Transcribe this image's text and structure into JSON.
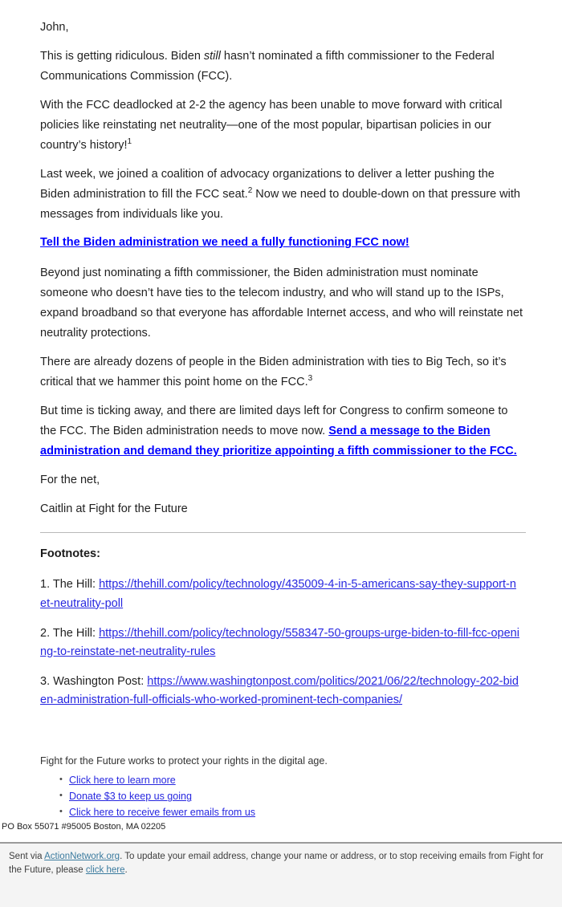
{
  "email": {
    "greeting": "John,",
    "paragraphs": [
      {
        "id": "p-ridiculous",
        "prefix": "This is getting ridiculous. Biden ",
        "italic": "still",
        "suffix": " hasn’t nominated a fifth commissioner to the Federal Communications Commission (FCC)."
      },
      {
        "id": "p-deadlock",
        "prefix": "With the FCC deadlocked at 2-2 the agency has been unable to move forward with critical policies like reinstating net neutrality—one of the most popular, bipartisan policies in our country’s history!",
        "superscript": "1",
        "suffix": ""
      },
      {
        "id": "p-coalition",
        "prefix": "Last week, we joined a coalition of advocacy organizations to deliver a letter pushing the Biden administration to fill the FCC seat.",
        "superscript": "2",
        "suffix": " Now we need to double-down on that pressure with messages from individuals like you."
      }
    ],
    "cta_primary": "Tell the Biden administration we need a fully functioning FCC now!",
    "paragraph_beyond": "Beyond just nominating a fifth commissioner, the Biden administration must nominate someone who doesn’t have ties to the telecom industry, and who will stand up to the ISPs, expand broadband so that everyone has affordable Internet access, and who will reinstate net neutrality protections.",
    "paragraph_bigtech": {
      "prefix": "There are already dozens of people in the Biden administration with ties to Big Tech, so it’s critical that we hammer this point home on the FCC.",
      "superscript": "3",
      "suffix": ""
    },
    "paragraph_ticking": {
      "prefix": "But time is ticking away, and there are limited days left for Congress to confirm someone to the FCC. The Biden administration needs to move now. ",
      "link": "Send a message to the Biden administration and demand they prioritize appointing a fifth commissioner to the FCC."
    },
    "signoff_line1": "For the net,",
    "signoff_line2": "Caitlin at Fight for the Future"
  },
  "footnotes": {
    "title": "Footnotes:",
    "items": [
      {
        "label": "1. The Hill: ",
        "url": "https://thehill.com/policy/technology/435009-4-in-5-americans-say-they-support-net-neutrality-poll"
      },
      {
        "label": "2. The Hill: ",
        "url": "https://thehill.com/policy/technology/558347-50-groups-urge-biden-to-fill-fcc-opening-to-reinstate-net-neutrality-rules"
      },
      {
        "label": "3. Washington Post: ",
        "url": "https://www.washingtonpost.com/politics/2021/06/22/technology-202-biden-administration-full-officials-who-worked-prominent-tech-companies/"
      }
    ]
  },
  "org_footer": {
    "tagline": "Fight for the Future works to protect your rights in the digital age.",
    "links": [
      "Click here to learn more",
      "Donate $3 to keep us going",
      "Click here to receive fewer emails from us"
    ]
  },
  "postal_address": "PO Box 55071 #95005 Boston, MA 02205",
  "action_bar": {
    "sent_via_prefix": "Sent via ",
    "provider_link": "ActionNetwork.org",
    "middle_text": ". To update your email address, change your name or address, or to stop receiving emails from Fight for the Future, please ",
    "click_here_link": "click here",
    "period": "."
  },
  "colors": {
    "cta_link": "#0000ff",
    "reference_link": "#2727e0",
    "footer_link": "#3a7a9e",
    "body_text": "#222222",
    "action_bar_bg": "#f4f4f4"
  }
}
